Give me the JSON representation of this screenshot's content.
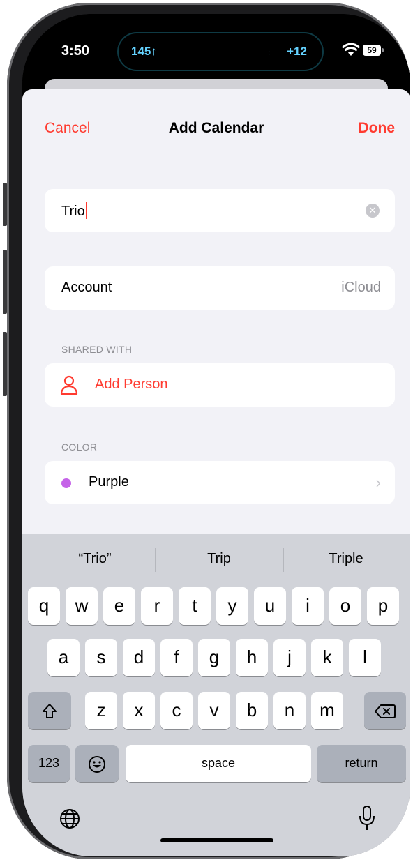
{
  "status_bar": {
    "time": "3:50",
    "island_left": "145↑",
    "island_dot": ":",
    "island_right": "+12",
    "battery": "59",
    "wifi_icon": "wifi-icon"
  },
  "nav": {
    "cancel": "Cancel",
    "title": "Add Calendar",
    "done": "Done"
  },
  "form": {
    "name_value": "Trio",
    "account_label": "Account",
    "account_value": "iCloud",
    "shared_header": "SHARED WITH",
    "add_person": "Add Person",
    "color_header": "COLOR",
    "color_label": "Purple"
  },
  "colors": {
    "accent": "#ff3b30",
    "purple_dot": "#c563e8",
    "sheet_bg": "#f2f2f7",
    "keyboard_bg": "#d1d3d9"
  },
  "keyboard": {
    "suggestions": [
      "“Trio”",
      "Trip",
      "Triple"
    ],
    "row1": [
      "q",
      "w",
      "e",
      "r",
      "t",
      "y",
      "u",
      "i",
      "o",
      "p"
    ],
    "row2": [
      "a",
      "s",
      "d",
      "f",
      "g",
      "h",
      "j",
      "k",
      "l"
    ],
    "row3": [
      "z",
      "x",
      "c",
      "v",
      "b",
      "n",
      "m"
    ],
    "shift_icon": "shift-icon",
    "delete_icon": "delete-icon",
    "numbers": "123",
    "emoji_icon": "emoji-icon",
    "space": "space",
    "return": "return",
    "globe_icon": "globe-icon",
    "mic_icon": "microphone-icon"
  }
}
